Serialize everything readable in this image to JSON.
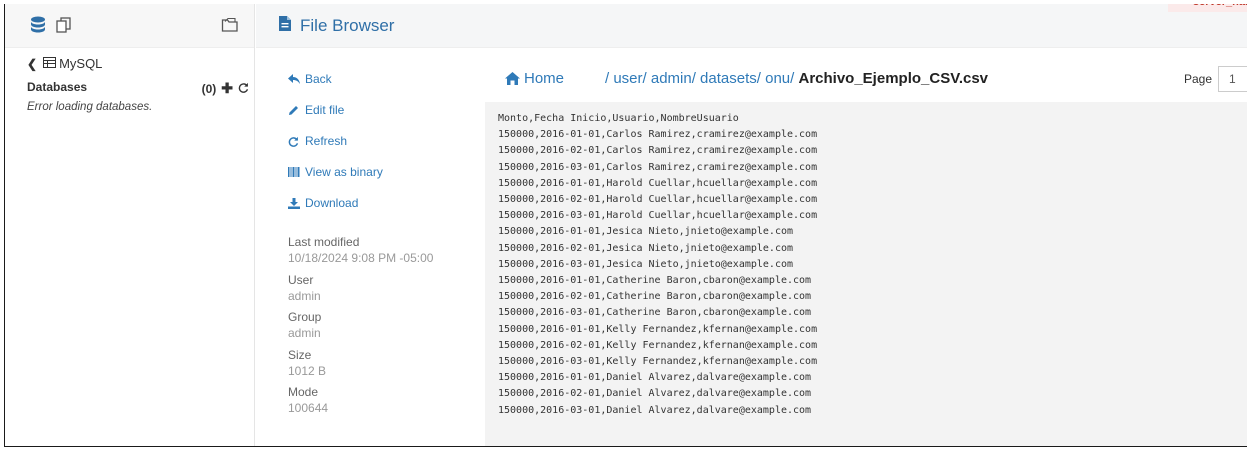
{
  "sidebar": {
    "icons": [
      "database-icon",
      "documents-icon",
      "folder-open-icon"
    ],
    "section_label": "MySQL",
    "databases_label": "Databases",
    "databases_count": "(0)",
    "error_text": "Error loading databases."
  },
  "header": {
    "title": "File Browser",
    "server_hint": "server_nam"
  },
  "actions": {
    "back": "Back",
    "edit": "Edit file",
    "refresh": "Refresh",
    "binary": "View as binary",
    "download": "Download"
  },
  "meta": {
    "modified_label": "Last modified",
    "modified_value": "10/18/2024 9:08 PM -05:00",
    "user_label": "User",
    "user_value": "admin",
    "group_label": "Group",
    "group_value": "admin",
    "size_label": "Size",
    "size_value": "1012 B",
    "mode_label": "Mode",
    "mode_value": "100644"
  },
  "breadcrumb": {
    "home": "Home",
    "segments": [
      "/ user",
      "/ admin",
      "/ datasets",
      "/ onu",
      "/ "
    ],
    "current": "Archivo_Ejemplo_CSV.csv"
  },
  "pager": {
    "label": "Page",
    "value": "1"
  },
  "file_lines": [
    "Monto,Fecha Inicio,Usuario,NombreUsuario",
    "150000,2016-01-01,Carlos Ramirez,cramirez@example.com",
    "150000,2016-02-01,Carlos Ramirez,cramirez@example.com",
    "150000,2016-03-01,Carlos Ramirez,cramirez@example.com",
    "150000,2016-01-01,Harold Cuellar,hcuellar@example.com",
    "150000,2016-02-01,Harold Cuellar,hcuellar@example.com",
    "150000,2016-03-01,Harold Cuellar,hcuellar@example.com",
    "150000,2016-01-01,Jesica Nieto,jnieto@example.com",
    "150000,2016-02-01,Jesica Nieto,jnieto@example.com",
    "150000,2016-03-01,Jesica Nieto,jnieto@example.com",
    "150000,2016-01-01,Catherine Baron,cbaron@example.com",
    "150000,2016-02-01,Catherine Baron,cbaron@example.com",
    "150000,2016-03-01,Catherine Baron,cbaron@example.com",
    "150000,2016-01-01,Kelly Fernandez,kfernan@example.com",
    "150000,2016-02-01,Kelly Fernandez,kfernan@example.com",
    "150000,2016-03-01,Kelly Fernandez,kfernan@example.com",
    "150000,2016-01-01,Daniel Alvarez,dalvare@example.com",
    "150000,2016-02-01,Daniel Alvarez,dalvare@example.com",
    "150000,2016-03-01,Daniel Alvarez,dalvare@example.com"
  ],
  "colors": {
    "link": "#2f7ab8",
    "title": "#2f6fa7",
    "content_bg": "#f3f3f3"
  }
}
